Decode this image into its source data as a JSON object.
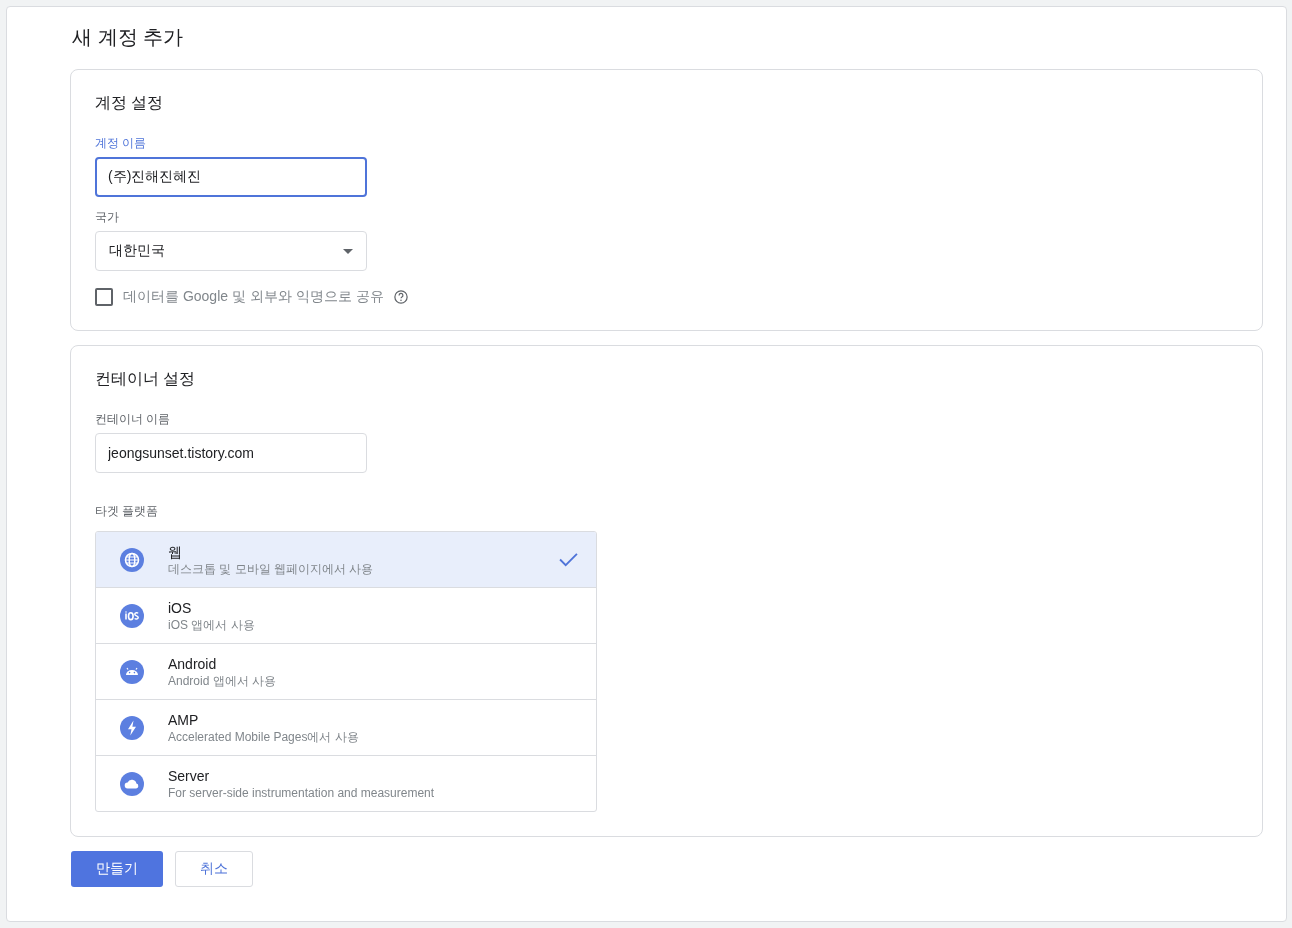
{
  "title": "새 계정 추가",
  "account": {
    "heading": "계정 설정",
    "name_field": {
      "label": "계정 이름",
      "value": "(주)진해진혜진",
      "focused": true
    },
    "country_field": {
      "label": "국가",
      "value": "대한민국"
    },
    "share_checkbox": {
      "label": "데이터를 Google 및 외부와 익명으로 공유",
      "checked": false
    }
  },
  "container": {
    "heading": "컨테이너 설정",
    "name_field": {
      "label": "컨테이너 이름",
      "value": "jeongsunset.tistory.com",
      "focused": false
    },
    "platform_label": "타겟 플랫폼",
    "platforms": [
      {
        "kind": "web",
        "title": "웹",
        "subtitle": "데스크톱 및 모바일 웹페이지에서 사용",
        "selected": true
      },
      {
        "kind": "ios",
        "title": "iOS",
        "subtitle": "iOS 앱에서 사용",
        "selected": false
      },
      {
        "kind": "android",
        "title": "Android",
        "subtitle": "Android 앱에서 사용",
        "selected": false
      },
      {
        "kind": "amp",
        "title": "AMP",
        "subtitle": "Accelerated Mobile Pages에서 사용",
        "selected": false
      },
      {
        "kind": "server",
        "title": "Server",
        "subtitle": "For server-side instrumentation and measurement",
        "selected": false
      }
    ]
  },
  "buttons": {
    "create": "만들기",
    "cancel": "취소"
  }
}
